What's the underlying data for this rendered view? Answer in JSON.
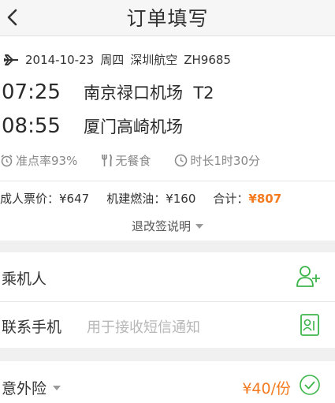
{
  "header": {
    "title": "订单填写",
    "back_icon": "chevron-left-icon"
  },
  "flight": {
    "date": "2014-10-23",
    "weekday": "周四",
    "airline": "深圳航空",
    "flight_no": "ZH9685",
    "departure": {
      "time": "07:25",
      "airport": "南京禄口机场  T2"
    },
    "arrival": {
      "time": "08:55",
      "airport": "厦门高崎机场"
    },
    "on_time": "准点率93%",
    "meal": "无餐食",
    "duration": "时长1时30分"
  },
  "prices": {
    "adult_ticket": "成人票价：¥647",
    "fuel_tax": "机建燃油：¥160",
    "total_label": "合计：",
    "total_value": "¥807"
  },
  "refund_link": "退改签说明",
  "form": {
    "passenger_label": "乘机人",
    "phone_label": "联系手机",
    "phone_placeholder": "用于接收短信通知"
  },
  "insurance": {
    "label": "意外险",
    "price": "¥40/份"
  },
  "colors": {
    "accent_orange": "#f47b20",
    "green": "#3cb54a"
  }
}
